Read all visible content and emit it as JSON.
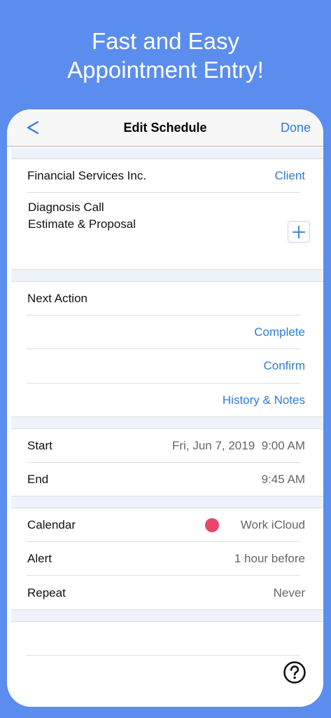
{
  "headline": {
    "line1": "Fast and Easy",
    "line2": "Appointment Entry!"
  },
  "navbar": {
    "title": "Edit Schedule",
    "done_label": "Done"
  },
  "client": {
    "name": "Financial Services Inc.",
    "button": "Client"
  },
  "services": {
    "line1": "Diagnosis Call",
    "line2": "Estimate & Proposal"
  },
  "next_action": {
    "label": "Next Action",
    "complete": "Complete",
    "confirm": "Confirm",
    "history": "History & Notes"
  },
  "time": {
    "start_label": "Start",
    "start_value": "Fri, Jun 7, 2019  9:00 AM",
    "end_label": "End",
    "end_value": "9:45 AM"
  },
  "settings": {
    "calendar_label": "Calendar",
    "calendar_value": "Work iCloud",
    "calendar_color": "#e9466b",
    "alert_label": "Alert",
    "alert_value": "1 hour before",
    "repeat_label": "Repeat",
    "repeat_value": "Never"
  },
  "colors": {
    "background": "#5b8def",
    "accent": "#2f7bd9"
  },
  "icons": {
    "back": "chevron-left-icon",
    "add": "plus-icon",
    "help": "help-circle-icon"
  }
}
